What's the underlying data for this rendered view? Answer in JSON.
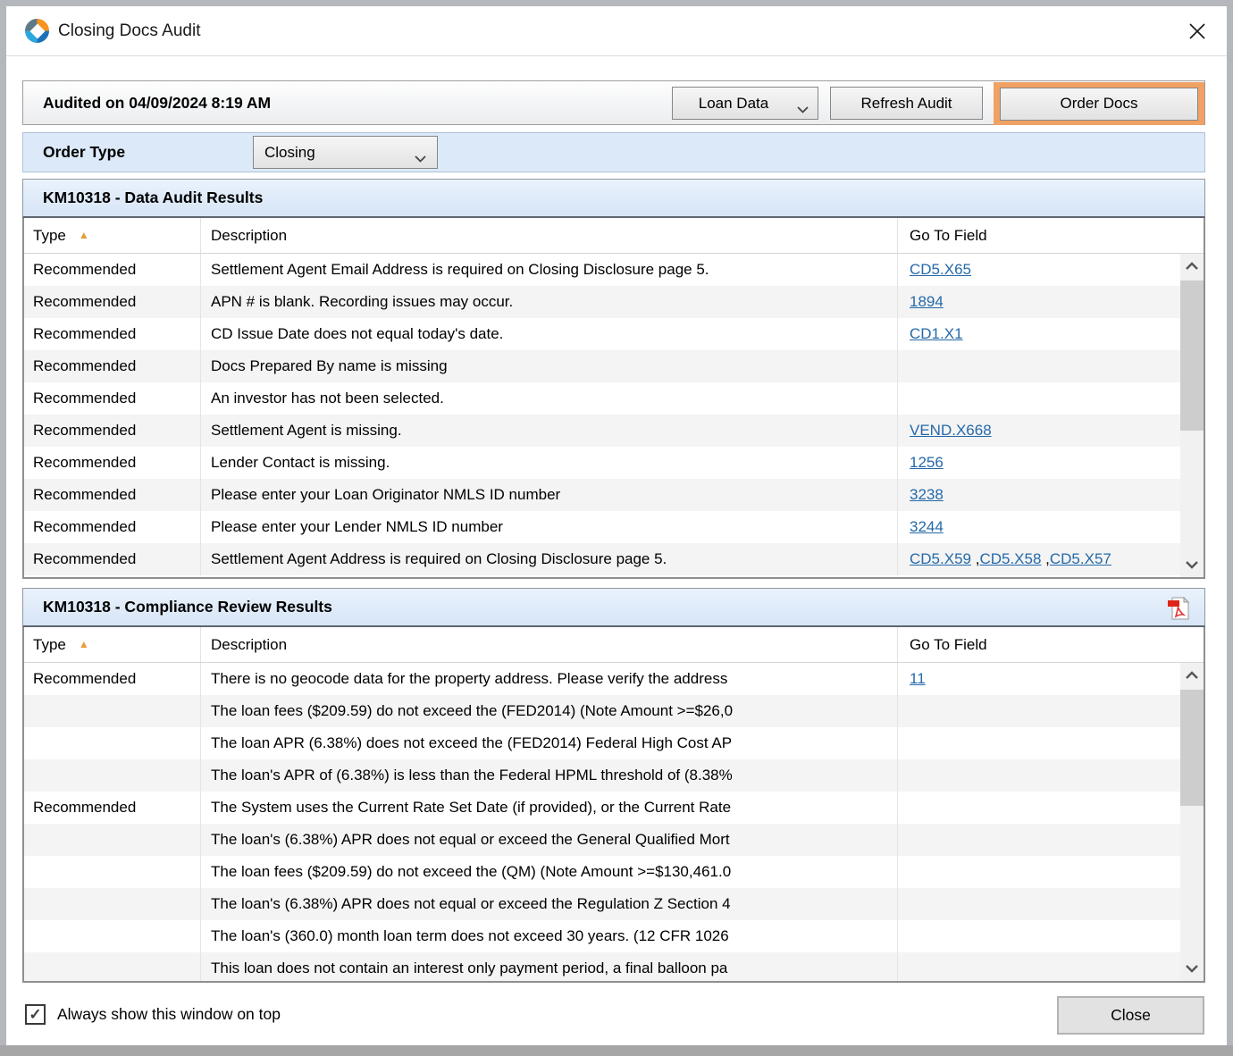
{
  "window": {
    "title": "Closing Docs Audit"
  },
  "toolbar": {
    "audited_text": "Audited on 04/09/2024 8:19 AM",
    "loan_data_label": "Loan Data",
    "refresh_button": "Refresh Audit",
    "order_docs_button": "Order Docs"
  },
  "order_type": {
    "label": "Order Type",
    "value": "Closing"
  },
  "data_audit": {
    "title": "KM10318 - Data Audit Results",
    "columns": {
      "type": "Type",
      "description": "Description",
      "goto": "Go To Field"
    },
    "rows": [
      {
        "type": "Recommended",
        "description": "Settlement Agent Email Address is required on Closing Disclosure page 5.",
        "links": [
          "CD5.X65"
        ]
      },
      {
        "type": "Recommended",
        "description": "APN # is blank. Recording issues may occur.",
        "links": [
          "1894"
        ]
      },
      {
        "type": "Recommended",
        "description": "CD Issue Date does not equal today's date.",
        "links": [
          "CD1.X1"
        ]
      },
      {
        "type": "Recommended",
        "description": "Docs Prepared By name is missing",
        "links": []
      },
      {
        "type": "Recommended",
        "description": "An investor has not been selected.",
        "links": []
      },
      {
        "type": "Recommended",
        "description": "Settlement Agent is missing.",
        "links": [
          "VEND.X668"
        ]
      },
      {
        "type": "Recommended",
        "description": "Lender Contact is missing.",
        "links": [
          "1256"
        ]
      },
      {
        "type": "Recommended",
        "description": "Please enter your Loan Originator NMLS ID number",
        "links": [
          "3238"
        ]
      },
      {
        "type": "Recommended",
        "description": "Please enter your Lender NMLS ID number",
        "links": [
          "3244"
        ]
      },
      {
        "type": "Recommended",
        "description": "Settlement Agent Address is required on Closing Disclosure page 5.",
        "links": [
          "CD5.X59",
          "CD5.X58",
          "CD5.X57"
        ]
      }
    ]
  },
  "compliance": {
    "title": "KM10318 - Compliance Review Results",
    "columns": {
      "type": "Type",
      "description": "Description",
      "goto": "Go To Field"
    },
    "rows": [
      {
        "type": "Recommended",
        "description": "There is no geocode data for the property address. Please verify the address",
        "links": [
          "11"
        ]
      },
      {
        "type": "",
        "description": "The loan fees ($209.59) do not exceed the (FED2014) (Note Amount >=$26,0",
        "links": []
      },
      {
        "type": "",
        "description": "The loan APR (6.38%) does not exceed the (FED2014) Federal High Cost AP",
        "links": []
      },
      {
        "type": "",
        "description": "The loan's APR of (6.38%) is less than the Federal HPML threshold of (8.38%",
        "links": []
      },
      {
        "type": "Recommended",
        "description": "The System uses the Current Rate Set Date (if provided), or the Current Rate",
        "links": []
      },
      {
        "type": "",
        "description": "The loan's (6.38%) APR does not equal or exceed the General Qualified Mort",
        "links": []
      },
      {
        "type": "",
        "description": "The loan fees ($209.59) do not exceed the (QM) (Note Amount >=$130,461.0",
        "links": []
      },
      {
        "type": "",
        "description": "The loan's (6.38%) APR does not equal or exceed the Regulation Z Section 4",
        "links": []
      },
      {
        "type": "",
        "description": "The loan's (360.0) month loan term does not exceed 30 years. (12 CFR 1026",
        "links": []
      },
      {
        "type": "",
        "description": "This loan does not contain an interest only payment period, a final balloon pa",
        "links": []
      }
    ]
  },
  "footer": {
    "checkbox_label": "Always show this window on top",
    "checkbox_checked": true,
    "checkmark": "✓",
    "close_button": "Close"
  },
  "misc": {
    "sort_arrow": "▲",
    "link_separator": " ,",
    "colors": {
      "order_docs_highlight": "#F0A164",
      "link_blue": "#2569A9",
      "section_header_blue": "#DCE9F8",
      "sort_arrow_orange": "#E79B3B"
    }
  }
}
